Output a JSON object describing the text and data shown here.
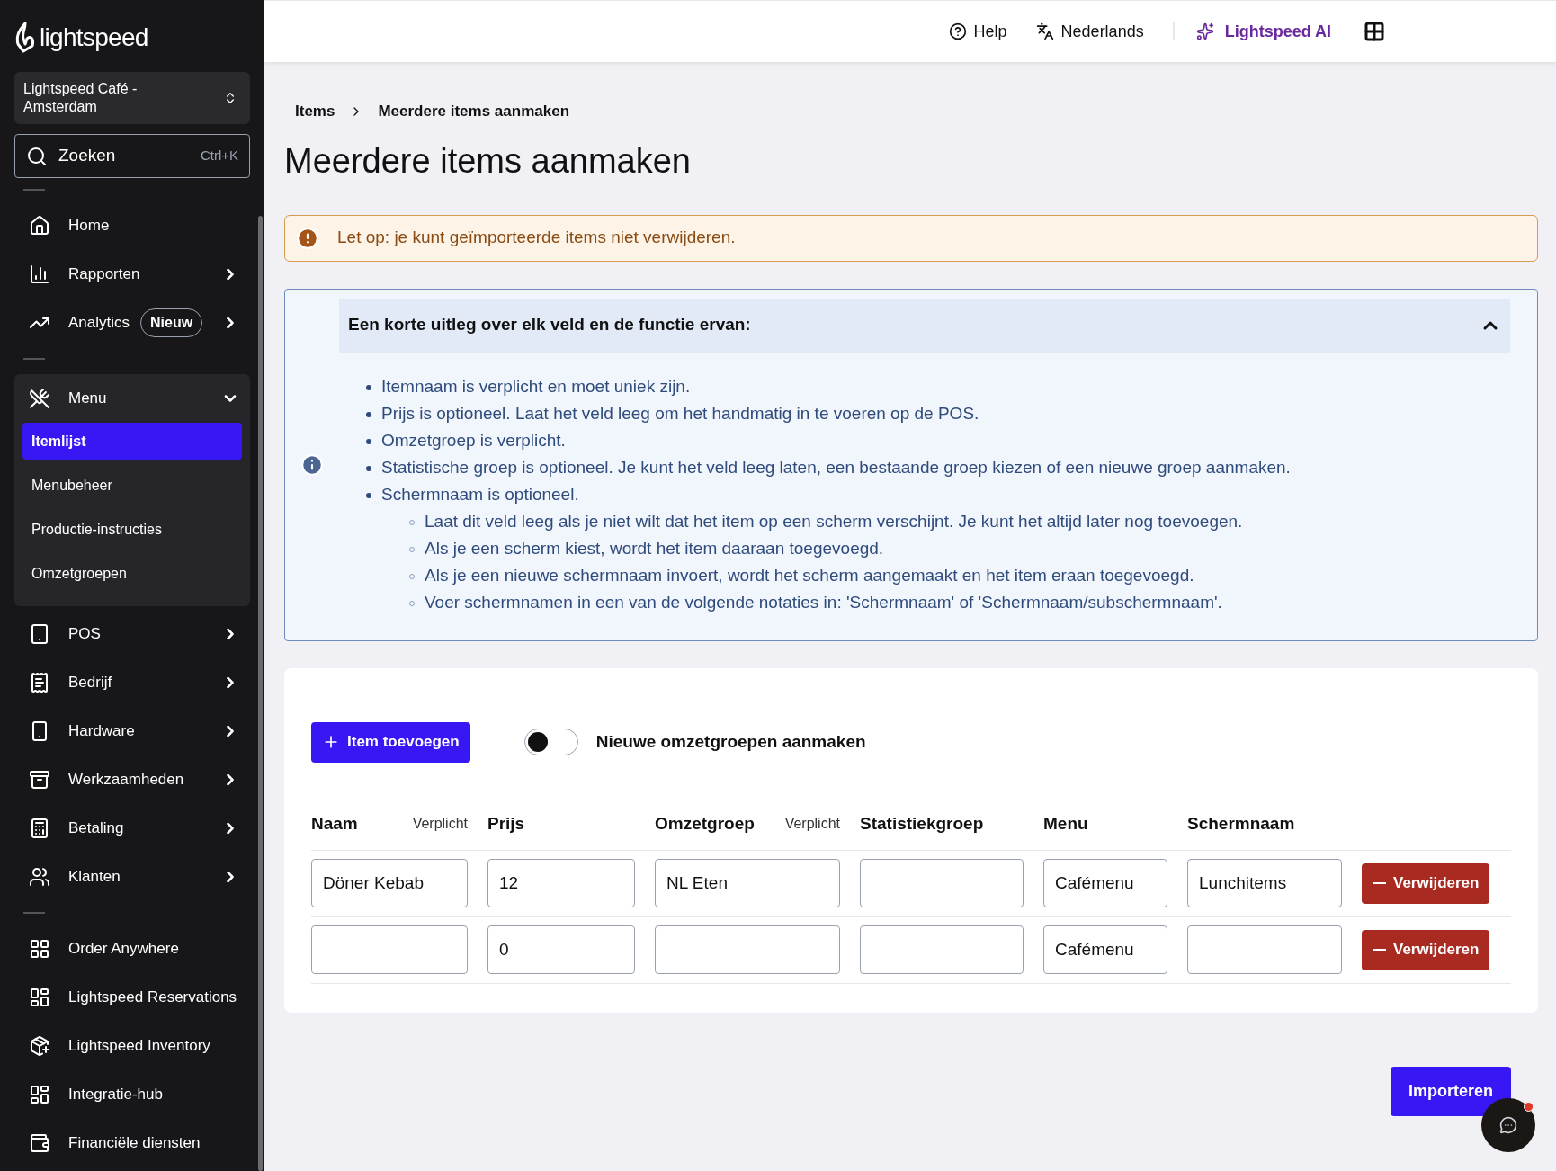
{
  "sidebar": {
    "brand": "lightspeed",
    "store": "Lightspeed Café - Amsterdam",
    "search": {
      "placeholder": "Zoeken",
      "shortcut": "Ctrl+K"
    },
    "groups": [
      [
        {
          "label": "Home",
          "has_submenu": false
        },
        {
          "label": "Rapporten",
          "has_submenu": true
        },
        {
          "label": "Analytics",
          "has_submenu": true,
          "badge": "Nieuw"
        }
      ],
      [
        {
          "label": "Menu",
          "has_submenu": true,
          "expanded": true,
          "children": [
            {
              "label": "Itemlijst",
              "selected": true
            },
            {
              "label": "Menubeheer",
              "selected": false
            },
            {
              "label": "Productie-instructies",
              "selected": false
            },
            {
              "label": "Omzetgroepen",
              "selected": false
            }
          ]
        },
        {
          "label": "POS",
          "has_submenu": true
        },
        {
          "label": "Bedrijf",
          "has_submenu": true
        },
        {
          "label": "Hardware",
          "has_submenu": true
        },
        {
          "label": "Werkzaamheden",
          "has_submenu": true
        },
        {
          "label": "Betaling",
          "has_submenu": true
        },
        {
          "label": "Klanten",
          "has_submenu": true
        }
      ],
      [
        {
          "label": "Order Anywhere",
          "has_submenu": false
        },
        {
          "label": "Lightspeed Reservations",
          "has_submenu": false
        },
        {
          "label": "Lightspeed Inventory",
          "has_submenu": false
        },
        {
          "label": "Integratie-hub",
          "has_submenu": false
        },
        {
          "label": "Financiële diensten",
          "has_submenu": false
        }
      ]
    ]
  },
  "topbar": {
    "help": "Help",
    "language": "Nederlands",
    "ai": "Lightspeed AI"
  },
  "breadcrumb": [
    "Items",
    "Meerdere items aanmaken"
  ],
  "title": "Meerdere items aanmaken",
  "alert": "Let op: je kunt geïmporteerde items niet verwijderen.",
  "info": {
    "heading": "Een korte uitleg over elk veld en de functie ervan:",
    "expanded": true,
    "items": [
      {
        "text": "Itemnaam is verplicht en moet uniek zijn."
      },
      {
        "text": "Prijs is optioneel. Laat het veld leeg om het handmatig in te voeren op de POS."
      },
      {
        "text": "Omzetgroep is verplicht."
      },
      {
        "text": "Statistische groep is optioneel. Je kunt het veld leeg laten, een bestaande groep kiezen of een nieuwe groep aanmaken."
      },
      {
        "text": "Schermnaam is optioneel.",
        "children": [
          {
            "text": "Laat dit veld leeg als je niet wilt dat het item op een scherm verschijnt. Je kunt het altijd later nog toevoegen."
          },
          {
            "text": "Als je een scherm kiest, wordt het item daaraan toegevoegd."
          },
          {
            "text": "Als je een nieuwe schermnaam invoert, wordt het scherm aangemaakt en het item eraan toegevoegd."
          },
          {
            "text": "Voer schermnamen in een van de volgende notaties in: 'Schermnaam' of 'Schermnaam/subschermnaam'."
          }
        ]
      }
    ]
  },
  "form": {
    "add_button": "Item toevoegen",
    "toggle": {
      "label": "Nieuwe omzetgroepen aanmaken",
      "on": false
    },
    "columns": [
      {
        "label": "Naam",
        "required": "Verplicht"
      },
      {
        "label": "Prijs"
      },
      {
        "label": "Omzetgroep",
        "required": "Verplicht"
      },
      {
        "label": "Statistiekgroep"
      },
      {
        "label": "Menu"
      },
      {
        "label": "Schermnaam"
      }
    ],
    "rows": [
      {
        "cells": [
          {
            "value": "Döner Kebab"
          },
          {
            "value": "12"
          },
          {
            "value": "NL Eten"
          },
          {},
          {
            "value": "Cafémenu"
          },
          {
            "value": "Lunchitems"
          }
        ],
        "remove": "Verwijderen"
      },
      {
        "cells": [
          {},
          {
            "value": "0"
          },
          {},
          {},
          {
            "value": "Cafémenu"
          },
          {}
        ],
        "remove": "Verwijderen"
      }
    ]
  },
  "import_button": "Importeren"
}
